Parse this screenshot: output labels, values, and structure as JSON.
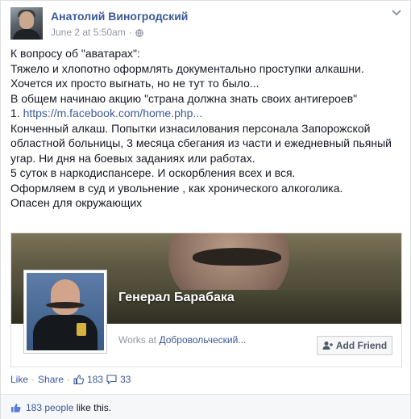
{
  "post": {
    "author": "Анатолий Виногродский",
    "timestamp": "June 2 at 5:50am",
    "privacy_icon": "globe-icon",
    "text": {
      "line1": "К вопросу об \"аватарах\":",
      "line2": "Тяжело и хлопотно оформлять документально проступки алкашни.",
      "line3": "Хочется их просто выгнать, но не тут то было...",
      "line4": "В общем начинаю акцию \"страна должна знать своих антигероев\"",
      "line5_prefix": "1. ",
      "line5_link": "https://m.facebook.com/home.php...",
      "line6": "Конченный алкаш. Попытки изнасилования персонала Запорожской",
      "line7": "областной больницы, 3 месяца сбегания из части и ежедневный пьяный",
      "line8": "угар. Ни дня на боевых заданиях или работах.",
      "line9": "5 суток в наркодиспансере. И оскорбления всех и вся.",
      "line10": "Оформляем в суд и увольнение , как хронического алкоголика.",
      "line11": "Опасен для окружающих"
    }
  },
  "shared_profile": {
    "name": "Генерал Барабака",
    "works_prefix": "Works at ",
    "works_place": "Добровольческий...",
    "add_friend_label": "Add Friend"
  },
  "actions": {
    "like": "Like",
    "separator": "·",
    "share": "Share",
    "likes_count": "183",
    "comments_count": "33"
  },
  "likes_bar": {
    "count_text": "183 people",
    "suffix": "like this."
  },
  "colors": {
    "link": "#3b5998",
    "muted": "#9197a3",
    "text": "#141823"
  }
}
